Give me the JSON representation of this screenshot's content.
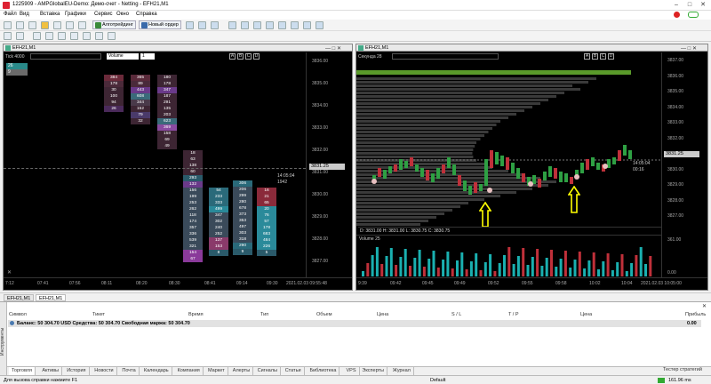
{
  "window": {
    "title": "1225909 - AMPGlobalEU-Demo: Демо-счет - Netting - EFH21,M1",
    "controls": [
      "–",
      "□",
      "✕"
    ]
  },
  "menu": [
    "Файл",
    "Вид",
    "Вставка",
    "Графики",
    "Сервис",
    "Окно",
    "Справка"
  ],
  "toolbar": {
    "algo_label": "Алготрейдинг",
    "new_order_label": "Новый ордер"
  },
  "left_chart": {
    "title": "EFH21,M1",
    "tick_label": "Tick 4000",
    "volume_label": "Volume",
    "volume_count": "1",
    "letters": [
      "A",
      "B",
      "C",
      "D"
    ],
    "prices": [
      "3836.00",
      "3835.00",
      "3834.00",
      "3833.00",
      "3832.00",
      "3831.00",
      "3830.00",
      "3829.00",
      "3828.00",
      "3827.00"
    ],
    "current_price": "3831.25",
    "time_left": "14:05:04",
    "tick_count": "1942",
    "times": [
      "7:12",
      "07:41",
      "07:56",
      "08:11",
      "08:20",
      "08:30",
      "08:41",
      "09:14",
      "09:30"
    ],
    "datetime": "2021.02.03 09:55:48",
    "top_badges": [
      "26",
      "9"
    ],
    "footprint_cols": [
      {
        "cells": [
          {
            "v": "384",
            "c": "#6b2a3a"
          },
          {
            "v": "178",
            "c": "#4b2a3a"
          },
          {
            "v": "30",
            "c": "#3d2533"
          },
          {
            "v": "100",
            "c": "#3d2533"
          },
          {
            "v": "94",
            "c": "#3d2533"
          },
          {
            "v": "26",
            "c": "#4a2a5a"
          }
        ]
      },
      {
        "cells": [
          {
            "v": "365",
            "c": "#5a2a3a"
          },
          {
            "v": "89",
            "c": "#4a2a3a"
          },
          {
            "v": "443",
            "c": "#6a3a8a"
          },
          {
            "v": "608",
            "c": "#3a6a7a"
          },
          {
            "v": "344",
            "c": "#4a3a4a"
          },
          {
            "v": "152",
            "c": "#3d2533"
          },
          {
            "v": "79",
            "c": "#4a3a6a"
          },
          {
            "v": "32",
            "c": "#3d2533"
          }
        ]
      },
      {
        "cells": [
          {
            "v": "180",
            "c": "#3d2533"
          },
          {
            "v": "178",
            "c": "#3d2533"
          },
          {
            "v": "347",
            "c": "#6a3a8a"
          },
          {
            "v": "187",
            "c": "#3d2533"
          },
          {
            "v": "291",
            "c": "#3d2533"
          },
          {
            "v": "135",
            "c": "#3d2533"
          },
          {
            "v": "203",
            "c": "#3d2533"
          },
          {
            "v": "623",
            "c": "#3a6a7a"
          },
          {
            "v": "369",
            "c": "#8a4aa0"
          },
          {
            "v": "158",
            "c": "#3d2533"
          },
          {
            "v": "69",
            "c": "#3d2533"
          },
          {
            "v": "49",
            "c": "#3d2533"
          }
        ]
      },
      {
        "cells": [
          {
            "v": "18",
            "c": "#3d2533"
          },
          {
            "v": "63",
            "c": "#3d2533"
          },
          {
            "v": "138",
            "c": "#3d2533"
          },
          {
            "v": "60",
            "c": "#3d2533"
          },
          {
            "v": "293",
            "c": "#2a5a6a"
          },
          {
            "v": "132",
            "c": "#6a3a8a"
          },
          {
            "v": "156",
            "c": "#3a4a5a"
          },
          {
            "v": "199",
            "c": "#3a4a5a"
          },
          {
            "v": "253",
            "c": "#3a4a5a"
          },
          {
            "v": "262",
            "c": "#3a4a5a"
          },
          {
            "v": "118",
            "c": "#3a4a5a"
          },
          {
            "v": "174",
            "c": "#3a4a5a"
          },
          {
            "v": "357",
            "c": "#3a4a5a"
          },
          {
            "v": "336",
            "c": "#3a4a5a"
          },
          {
            "v": "539",
            "c": "#3a4a5a"
          },
          {
            "v": "321",
            "c": "#3a4a5a"
          },
          {
            "v": "154",
            "c": "#8a3a9a"
          },
          {
            "v": "67",
            "c": "#8a3a9a"
          }
        ]
      },
      {
        "cells": [
          {
            "v": "54",
            "c": "#2a6a7a"
          },
          {
            "v": "233",
            "c": "#2a6a7a"
          },
          {
            "v": "333",
            "c": "#2a6a7a"
          },
          {
            "v": "499",
            "c": "#2a8a9a"
          },
          {
            "v": "347",
            "c": "#3a4a5a"
          },
          {
            "v": "302",
            "c": "#3a4a5a"
          },
          {
            "v": "240",
            "c": "#3a4a5a"
          },
          {
            "v": "252",
            "c": "#3a4a5a"
          },
          {
            "v": "137",
            "c": "#8a3a6a"
          },
          {
            "v": "153",
            "c": "#8a3a6a"
          },
          {
            "v": "8",
            "c": "#2a5a6a"
          }
        ]
      },
      {
        "cells": [
          {
            "v": "306",
            "c": "#2a6a7a"
          },
          {
            "v": "206",
            "c": "#3a4a5a"
          },
          {
            "v": "299",
            "c": "#3a4a5a"
          },
          {
            "v": "280",
            "c": "#3a4a5a"
          },
          {
            "v": "678",
            "c": "#3a4a5a"
          },
          {
            "v": "373",
            "c": "#3a4a5a"
          },
          {
            "v": "353",
            "c": "#3a4a5a"
          },
          {
            "v": "497",
            "c": "#3a4a5a"
          },
          {
            "v": "303",
            "c": "#3a4a5a"
          },
          {
            "v": "318",
            "c": "#3a4a5a"
          },
          {
            "v": "290",
            "c": "#2a6a7a"
          },
          {
            "v": "9",
            "c": "#2a5a6a"
          }
        ]
      },
      {
        "cells": [
          {
            "v": "16",
            "c": "#8a2a3a"
          },
          {
            "v": "21",
            "c": "#8a2a3a"
          },
          {
            "v": "65",
            "c": "#8a2a3a"
          },
          {
            "v": "20",
            "c": "#2a8a9a"
          },
          {
            "v": "76",
            "c": "#2a8a9a"
          },
          {
            "v": "57",
            "c": "#2a8a9a"
          },
          {
            "v": "178",
            "c": "#2a8a9a"
          },
          {
            "v": "683",
            "c": "#2a8a9a"
          },
          {
            "v": "484",
            "c": "#2a8a9a"
          },
          {
            "v": "226",
            "c": "#2a8a9a"
          },
          {
            "v": "5",
            "c": "#2a5a6a"
          }
        ]
      }
    ]
  },
  "right_chart": {
    "title": "EFH21,M1",
    "session_label": "Секунда",
    "session_count": "28",
    "letters": [
      "A",
      "B",
      "C",
      "D"
    ],
    "prices": [
      "3837.00",
      "3836.00",
      "3835.00",
      "3834.00",
      "3833.00",
      "3832.00",
      "3831.00",
      "3830.00",
      "3829.00",
      "3828.00",
      "3827.00"
    ],
    "current_price": "3831.25",
    "time_left": "14:05:04",
    "small_time": "00:16",
    "ohlc": "D: 3831.00   H: 3831.00   L: 3830.75   C: 3830.75",
    "volume_label": "Volume 25",
    "volume_scale_top": "361.00",
    "volume_scale_bottom": "0.00",
    "times": [
      "9:39",
      "09:42",
      "09:45",
      "09:49",
      "09:52",
      "09:55",
      "09:58",
      "10:02",
      "10:04"
    ],
    "datetime": "2021.02.03 10:05:00"
  },
  "bottom": {
    "tabs": [
      "EFH21,M1",
      "EFH21,M1"
    ],
    "columns": [
      "Символ",
      "Тикет",
      "Время",
      "Тип",
      "Объем",
      "Цена",
      "S / L",
      "T / P",
      "Цена",
      "Прибыль"
    ],
    "balance_row": "Баланс: 50 304.70 USD  Средства: 50 304.70  Свободная маржа: 50 304.70",
    "profit": "0.00",
    "side_label": "Инструменты",
    "terminal_tabs": [
      "Торговля",
      "Активы",
      "История",
      "Новости",
      "Почта",
      "Календарь",
      "Компания",
      "Маркет",
      "Алерты",
      "Сигналы",
      "Статьи",
      "Библиотека",
      "VPS",
      "Эксперты",
      "Журнал"
    ],
    "strategy_tester": "Тестер стратегий"
  },
  "statusbar": {
    "help": "Для вызова справки нажмите F1",
    "profile": "Default",
    "ping": "161.96 ms"
  }
}
